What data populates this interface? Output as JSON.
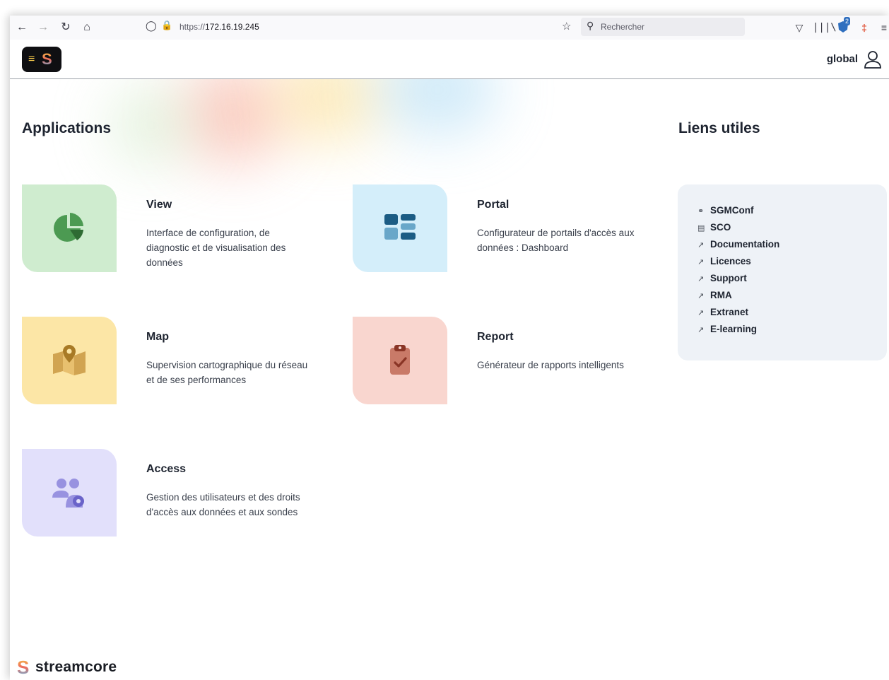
{
  "browser": {
    "url_prefix": "https://",
    "url_host": "172.16.19.245",
    "search_placeholder": "Rechercher",
    "notification_count": "2"
  },
  "header": {
    "user_name": "global"
  },
  "applications": {
    "title": "Applications",
    "items": [
      {
        "name": "View",
        "description": "Interface de configuration, de diagnostic et de visualisation des données",
        "icon": "pie-chart-icon",
        "tile_color": "#cfeccf",
        "icon_color": "#4c9a52"
      },
      {
        "name": "Portal",
        "description": "Configurateur de portails d'accès aux données : Dashboard",
        "icon": "dashboard-icon",
        "tile_color": "#d4eefa",
        "icon_color": "#1b5c84"
      },
      {
        "name": "Map",
        "description": "Supervision cartographique du réseau et de ses performances",
        "icon": "map-pin-icon",
        "tile_color": "#fce6a6",
        "icon_color": "#a87a25"
      },
      {
        "name": "Report",
        "description": "Générateur de rapports intelligents",
        "icon": "clipboard-check-icon",
        "tile_color": "#f9d6cf",
        "icon_color": "#8a3526"
      },
      {
        "name": "Access",
        "description": "Gestion des utilisateurs et des droits d'accès aux données et aux sondes",
        "icon": "users-gear-icon",
        "tile_color": "#e2e0fb",
        "icon_color": "#6a63c9"
      }
    ]
  },
  "useful_links": {
    "title": "Liens utiles",
    "items": [
      {
        "label": "SGMConf",
        "icon": "link-chain-icon"
      },
      {
        "label": "SCO",
        "icon": "document-icon"
      },
      {
        "label": "Documentation",
        "icon": "external-link-icon"
      },
      {
        "label": "Licences",
        "icon": "external-link-icon"
      },
      {
        "label": "Support",
        "icon": "external-link-icon"
      },
      {
        "label": "RMA",
        "icon": "external-link-icon"
      },
      {
        "label": "Extranet",
        "icon": "external-link-icon"
      },
      {
        "label": "E-learning",
        "icon": "external-link-icon"
      }
    ]
  },
  "footer": {
    "brand": "streamcore"
  }
}
